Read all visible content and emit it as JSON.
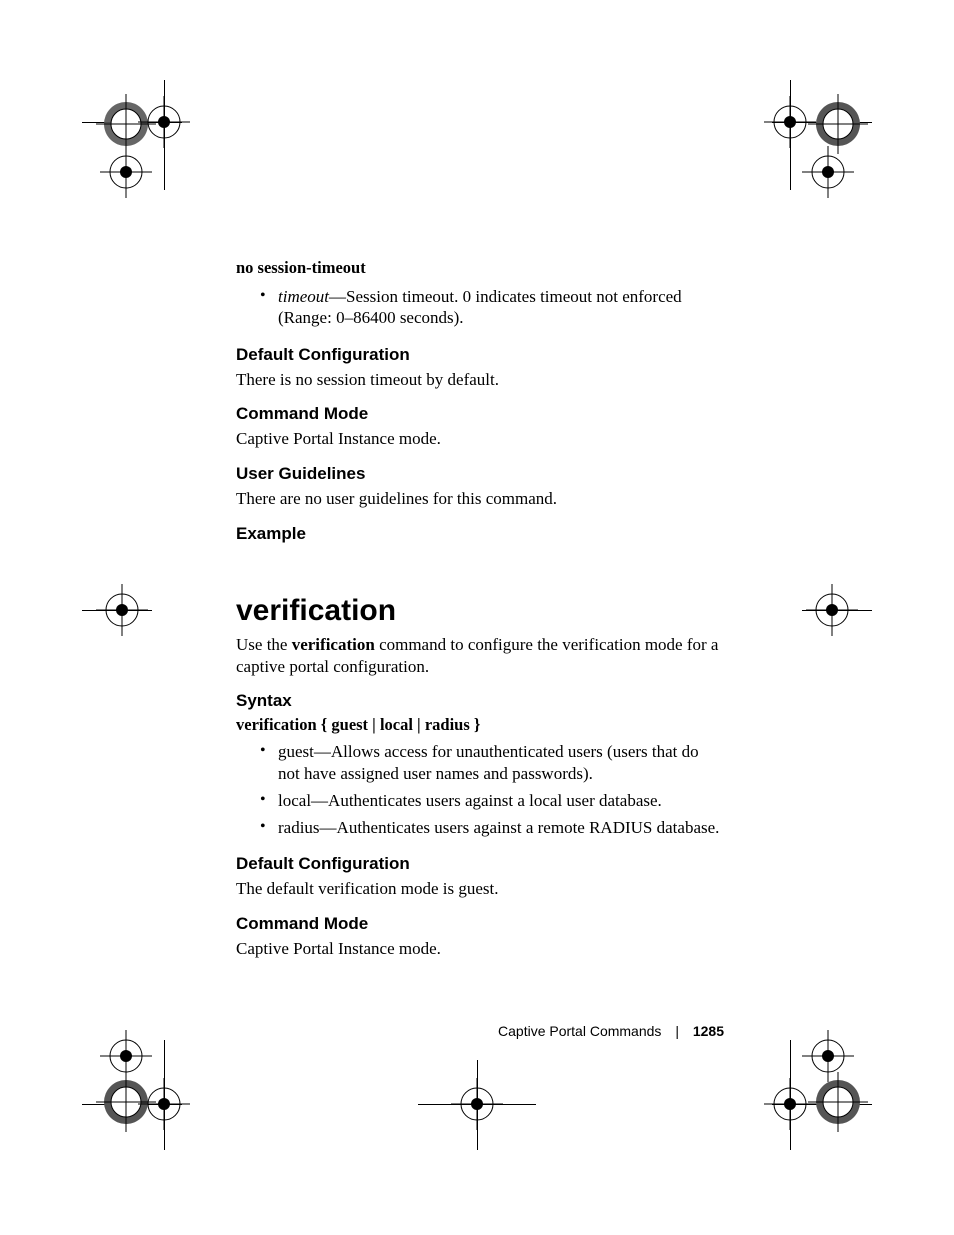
{
  "section1": {
    "cmd_bold": "no session-timeout",
    "bullet_param_italic": "timeout",
    "bullet_param_rest": "—Session timeout. 0 indicates timeout not enforced (Range: 0–86400 seconds).",
    "h_default": "Default Configuration",
    "p_default": "There is no session timeout by default.",
    "h_mode": "Command Mode",
    "p_mode": "Captive Portal Instance mode.",
    "h_guidelines": "User Guidelines",
    "p_guidelines": "There are no user guidelines for this command.",
    "h_example": "Example"
  },
  "section2": {
    "title": "verification",
    "intro_pre": "Use the ",
    "intro_bold": "verification",
    "intro_post": " command to configure the verification mode for a captive portal configuration.",
    "h_syntax": "Syntax",
    "syntax_line": "verification { guest | local | radius }",
    "bullets": [
      "guest—Allows access for unauthenticated users (users that do not have assigned user names and passwords).",
      "local—Authenticates users against a local user database.",
      "radius—Authenticates users against a remote RADIUS database."
    ],
    "h_default": "Default Configuration",
    "p_default": "The default verification mode is guest.",
    "h_mode": "Command Mode",
    "p_mode": "Captive Portal Instance mode."
  },
  "footer": {
    "section_name": "Captive Portal Commands",
    "page_number": "1285"
  }
}
